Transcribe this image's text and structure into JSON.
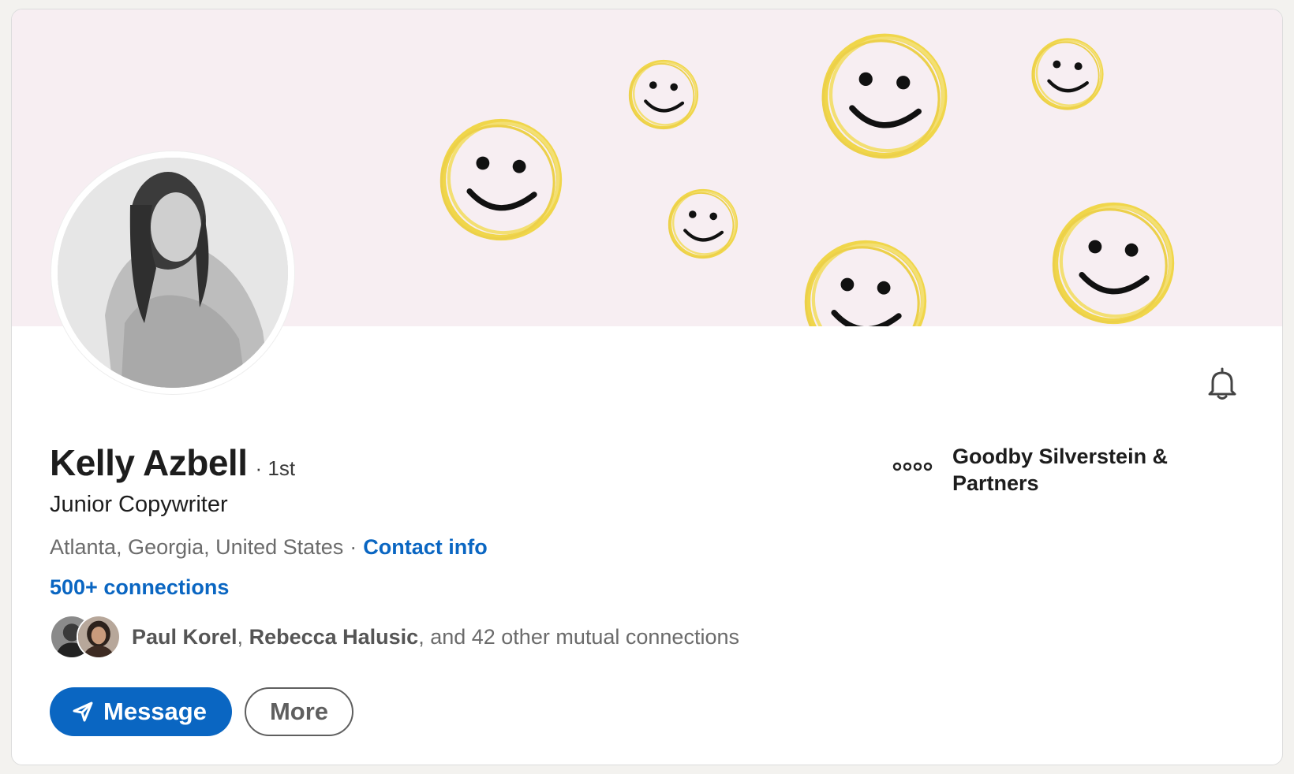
{
  "profile": {
    "name": "Kelly Azbell",
    "degree": "· 1st",
    "headline": "Junior Copywriter",
    "location": "Atlanta, Georgia, United States",
    "separator": "·",
    "contact_info": "Contact info",
    "connections": "500+ connections"
  },
  "mutual": {
    "first": "Paul Korel",
    "comma": ",",
    "second": "Rebecca Halusic",
    "rest": ", and 42 other mutual connections"
  },
  "actions": {
    "message_label": "Message",
    "more_label": "More"
  },
  "company": {
    "name": "Goodby Silverstein & Partners",
    "logo_icon": "dots-logo-icon"
  },
  "icons": {
    "bell": "bell-icon",
    "send": "send-icon"
  },
  "colors": {
    "accent": "#0a66c2",
    "banner_bg": "#f7eef2",
    "smiley_yellow": "#f0d64a"
  }
}
